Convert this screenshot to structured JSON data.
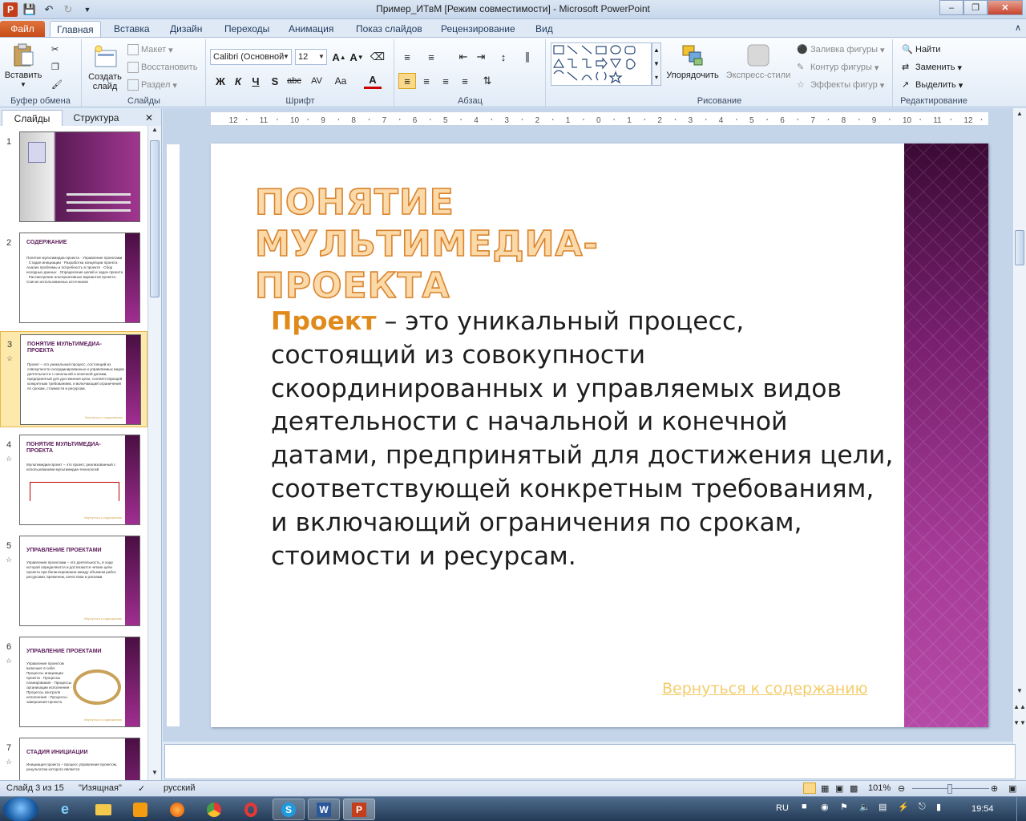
{
  "window": {
    "title": "Пример_ИТвМ [Режим совместимости]  -  Microsoft PowerPoint"
  },
  "tabs": [
    "Файл",
    "Главная",
    "Вставка",
    "Дизайн",
    "Переходы",
    "Анимация",
    "Показ слайдов",
    "Рецензирование",
    "Вид"
  ],
  "active_tab": "Главная",
  "ribbon": {
    "clipboard": {
      "paste": "Вставить",
      "label": "Буфер обмена"
    },
    "slides": {
      "new_slide": "Создать слайд",
      "layout": "Макет",
      "reset": "Восстановить",
      "section": "Раздел",
      "label": "Слайды"
    },
    "font": {
      "name": "Calibri (Основной",
      "size": "12",
      "label": "Шрифт"
    },
    "paragraph": {
      "label": "Абзац"
    },
    "drawing": {
      "arrange": "Упорядочить",
      "quick_styles": "Экспресс-стили",
      "fill": "Заливка фигуры",
      "outline": "Контур фигуры",
      "effects": "Эффекты фигур",
      "label": "Рисование"
    },
    "editing": {
      "find": "Найти",
      "replace": "Заменить",
      "select": "Выделить",
      "label": "Редактирование"
    }
  },
  "left_panel": {
    "tabs": [
      "Слайды",
      "Структура"
    ],
    "thumbnails": [
      {
        "num": "1",
        "title": "",
        "text": ""
      },
      {
        "num": "2",
        "title": "СОДЕРЖАНИЕ",
        "text": "Понятие мультимедиа-проекта · Управление проектами · Стадия инициации · Разработка концепции проекта · Анализ проблемы и потребность в проекте · Сбор исходных данных · Определение целей и задач проекта · Рассмотрение альтернативных вариантов проекта · Список использованных источников"
      },
      {
        "num": "3",
        "title": "ПОНЯТИЕ МУЛЬТИМЕДИА-ПРОЕКТА",
        "text": "Проект – это уникальный процесс, состоящий из совокупности скоординированных и управляемых видов деятельности с начальной и конечной датами, предпринятый для достижения цели, соответствующей конкретным требованиям, и включающий ограничения по срокам, стоимости и ресурсам."
      },
      {
        "num": "4",
        "title": "ПОНЯТИЕ МУЛЬТИМЕДИА-ПРОЕКТА",
        "text": "Мультимедиа-проект – это проект, реализованный с использованием мультимедиа-технологий"
      },
      {
        "num": "5",
        "title": "УПРАВЛЕНИЕ ПРОЕКТАМИ",
        "text": "Управление проектами – это деятельность, в ходе которой определяются и достигаются четкие цели проекта при балансировании между объемом работ, ресурсами, временем, качеством и рисками."
      },
      {
        "num": "6",
        "title": "УПРАВЛЕНИЕ ПРОЕКТАМИ",
        "text": "Управление проектом включает в себя: Процессы инициации проекта · Процессы планирования · Процессы организации исполнения · Процессы контроля исполнения · Процессы завершения проекта"
      },
      {
        "num": "7",
        "title": "СТАДИЯ ИНИЦИАЦИИ",
        "text": "Инициация проекта – процесс управления проектом, результатом которого является"
      }
    ]
  },
  "slide": {
    "title": "Понятие мультимедиа-проекта",
    "keyword": "Проект",
    "body": "  –  это уникальный процесс, состоящий из совокупности скоординированных и управляемых видов деятельности с начальной и конечной датами, предпринятый для достижения цели, соответствующей конкретным требованиям, и включающий ограничения по срокам, стоимости и ресурсам.",
    "link": "Вернуться к содержанию"
  },
  "status": {
    "slide_info": "Слайд 3 из 15",
    "theme": "\"Изящная\"",
    "language": "русский",
    "zoom": "101%"
  },
  "taskbar": {
    "lang": "RU",
    "time": "19:54"
  },
  "colors": {
    "accent_purple": "#7a2071",
    "title_orange": "#d9842c",
    "link_gold": "#f4cd6c",
    "file_tab": "#c74b17"
  }
}
